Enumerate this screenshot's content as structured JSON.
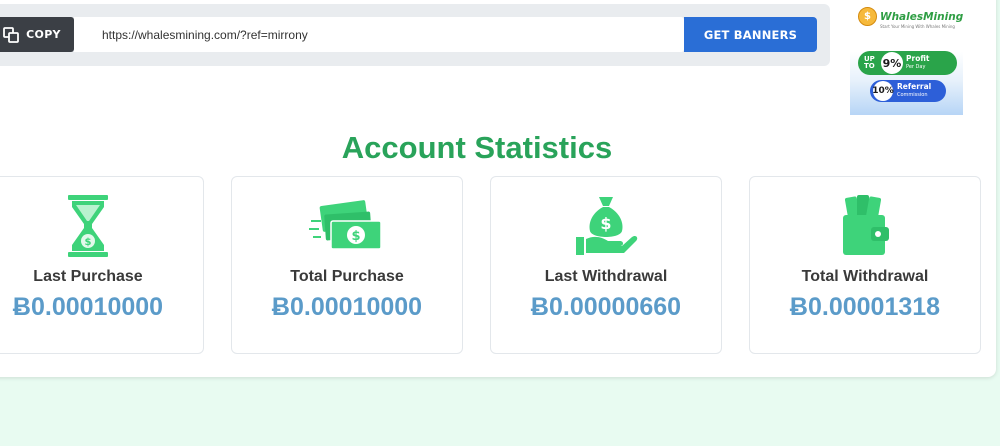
{
  "referral": {
    "copy_label": "COPY",
    "link": "https://whalesmining.com/?ref=mirrony",
    "get_banners_label": "GET BANNERS"
  },
  "ad": {
    "brand": "WhalesMining",
    "tagline": "Start Your Mining With Whales Mining",
    "up_to": "UP TO",
    "profit_pct": "9%",
    "profit_label": "Profit",
    "profit_sub": "Per Day",
    "referral_pct": "10%",
    "referral_label": "Referral",
    "referral_sub": "Commission"
  },
  "section_title": "Account Statistics",
  "stats": [
    {
      "label": "Last Purchase",
      "value": "Ƀ0.00010000",
      "icon": "hourglass-icon"
    },
    {
      "label": "Total Purchase",
      "value": "Ƀ0.00010000",
      "icon": "money-stack-icon"
    },
    {
      "label": "Last Withdrawal",
      "value": "Ƀ0.00000660",
      "icon": "money-bag-hand-icon"
    },
    {
      "label": "Total Withdrawal",
      "value": "Ƀ0.00001318",
      "icon": "wallet-icon"
    }
  ],
  "colors": {
    "accent_green": "#29a35a",
    "icon_green": "#3ed37a",
    "value_blue": "#5b9bc9",
    "button_blue": "#2a6ed6",
    "copy_dark": "#3b3f45",
    "page_bg": "#e8fbf1"
  }
}
